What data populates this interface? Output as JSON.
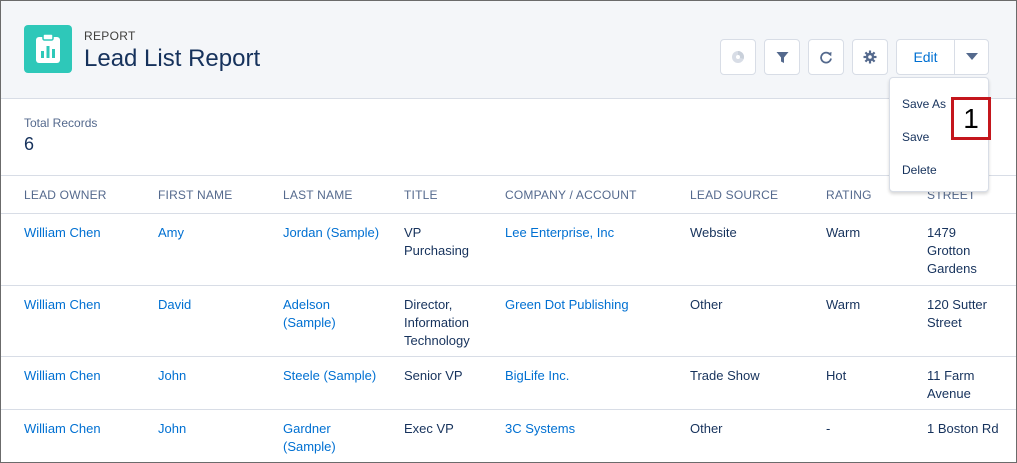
{
  "header": {
    "eyebrow": "REPORT",
    "title": "Lead List Report",
    "edit_label": "Edit"
  },
  "summary": {
    "label": "Total Records",
    "value": "6"
  },
  "columns": [
    "LEAD OWNER",
    "FIRST NAME",
    "LAST NAME",
    "TITLE",
    "COMPANY / ACCOUNT",
    "LEAD SOURCE",
    "RATING",
    "STREET"
  ],
  "rows": [
    {
      "owner": "William Chen",
      "first": "Amy",
      "last": [
        "Jordan (Sample)"
      ],
      "title": [
        "VP",
        "Purchasing"
      ],
      "company": "Lee Enterprise, Inc",
      "source": "Website",
      "rating": "Warm",
      "street": [
        "1479",
        "Grotton",
        "Gardens"
      ]
    },
    {
      "owner": "William Chen",
      "first": "David",
      "last": [
        "Adelson",
        "(Sample)"
      ],
      "title": [
        "Director,",
        "Information",
        "Technology"
      ],
      "company": "Green Dot Publishing",
      "source": "Other",
      "rating": "Warm",
      "street": [
        "120 Sutter",
        "Street"
      ]
    },
    {
      "owner": "William Chen",
      "first": "John",
      "last": [
        "Steele (Sample)"
      ],
      "title": [
        "Senior VP"
      ],
      "company": "BigLife Inc.",
      "source": "Trade Show",
      "rating": "Hot",
      "street": [
        "11 Farm",
        "Avenue"
      ]
    },
    {
      "owner": "William Chen",
      "first": "John",
      "last": [
        "Gardner",
        "(Sample)"
      ],
      "title": [
        "Exec VP"
      ],
      "company": "3C Systems",
      "source": "Other",
      "rating": "-",
      "street": [
        "1 Boston Rd"
      ]
    }
  ],
  "menu": {
    "save_as": "Save As",
    "save": "Save",
    "delete": "Delete"
  },
  "callout": {
    "number": "1"
  },
  "colors": {
    "brand": "#2ec8b9",
    "link": "#0070d2",
    "callout_border": "#c4161c",
    "header_bg": "#f4f6f9"
  },
  "icons": [
    "report-icon",
    "chart-icon",
    "filter-icon",
    "refresh-icon",
    "gear-icon",
    "chevron-down-icon"
  ]
}
